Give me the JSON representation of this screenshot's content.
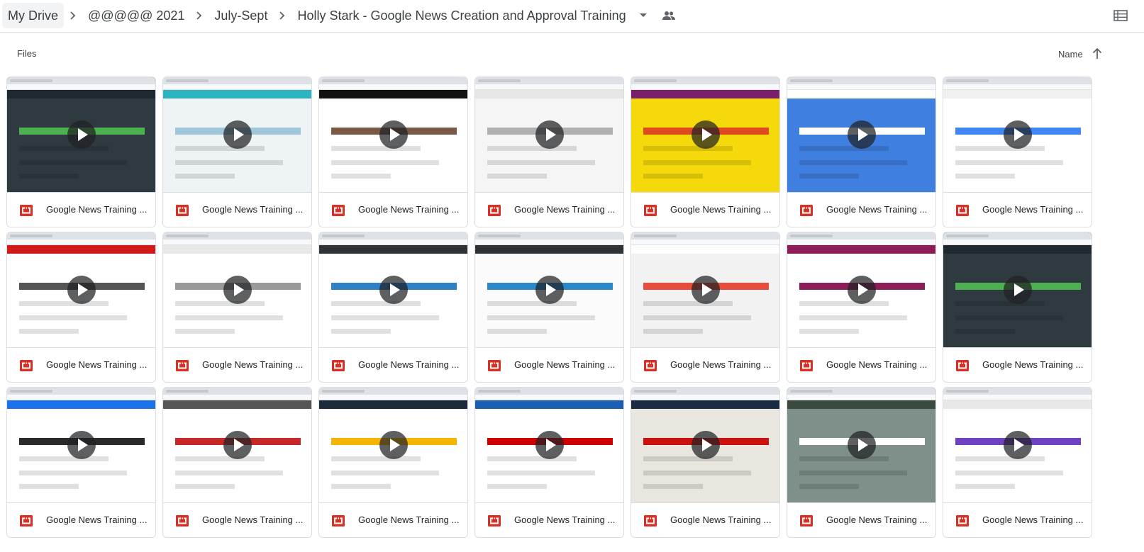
{
  "breadcrumb": {
    "items": [
      {
        "label": "My Drive"
      },
      {
        "label": "@@@@@ 2021"
      },
      {
        "label": "July-Sept"
      },
      {
        "label": "Holly Stark - Google News Creation and Approval Training"
      }
    ]
  },
  "icons": {
    "separator": "chevron-right-icon",
    "dropdown": "arrow-drop-down-icon",
    "shared": "people-icon",
    "view": "list-view-icon",
    "sort": "arrow-upward-icon",
    "play": "play-icon",
    "file_type": "video-file-icon"
  },
  "files_section": {
    "title": "Files",
    "sort_label": "Name",
    "sort_direction": "ascending"
  },
  "colors": {
    "video_icon": "#d93025",
    "text": "#3c4043",
    "border": "#dadce0",
    "crumb_bg": "#f1f3f4"
  },
  "files": [
    {
      "name": "Google News Training ...",
      "thumb": {
        "bg": "#2f3a40",
        "hdr": "#1f2a30",
        "accent": "#4caf50"
      }
    },
    {
      "name": "Google News Training ...",
      "thumb": {
        "bg": "#eef3f6",
        "hdr": "#2bb3c0",
        "accent": "#9fc6d9"
      }
    },
    {
      "name": "Google News Training ...",
      "thumb": {
        "bg": "#ffffff",
        "hdr": "#111111",
        "accent": "#7a5a45"
      }
    },
    {
      "name": "Google News Training ...",
      "thumb": {
        "bg": "#f5f5f5",
        "hdr": "#e6e6e6",
        "accent": "#b0b0b0"
      }
    },
    {
      "name": "Google News Training ...",
      "thumb": {
        "bg": "#f5d90a",
        "hdr": "#7a1f6b",
        "accent": "#e04a1f"
      }
    },
    {
      "name": "Google News Training ...",
      "thumb": {
        "bg": "#3f7fe0",
        "hdr": "#ffffff",
        "accent": "#ffffff"
      }
    },
    {
      "name": "Google News Training ...",
      "thumb": {
        "bg": "#ffffff",
        "hdr": "#f0f0f0",
        "accent": "#4285f4"
      }
    },
    {
      "name": "Google News Training ...",
      "thumb": {
        "bg": "#ffffff",
        "hdr": "#d11b1b",
        "accent": "#555555"
      }
    },
    {
      "name": "Google News Training ...",
      "thumb": {
        "bg": "#ffffff",
        "hdr": "#e8e8e8",
        "accent": "#999999"
      }
    },
    {
      "name": "Google News Training ...",
      "thumb": {
        "bg": "#ffffff",
        "hdr": "#2e3338",
        "accent": "#2f80c4"
      }
    },
    {
      "name": "Google News Training ...",
      "thumb": {
        "bg": "#fbfbfb",
        "hdr": "#2e3338",
        "accent": "#2a87c8"
      }
    },
    {
      "name": "Google News Training ...",
      "thumb": {
        "bg": "#f2f2f2",
        "hdr": "#ffffff",
        "accent": "#e74c3c"
      }
    },
    {
      "name": "Google News Training ...",
      "thumb": {
        "bg": "#ffffff",
        "hdr": "#8c1d59",
        "accent": "#8c1d59"
      }
    },
    {
      "name": "Google News Training ...",
      "thumb": {
        "bg": "#2f3a40",
        "hdr": "#1f2a30",
        "accent": "#4caf50"
      }
    },
    {
      "name": "Google News Training ...",
      "thumb": {
        "bg": "#ffffff",
        "hdr": "#1a73e8",
        "accent": "#2b2b2b"
      }
    },
    {
      "name": "Google News Training ...",
      "thumb": {
        "bg": "#ffffff",
        "hdr": "#555555",
        "accent": "#c62828"
      }
    },
    {
      "name": "Google News Training ...",
      "thumb": {
        "bg": "#ffffff",
        "hdr": "#1c2a3a",
        "accent": "#f4b400"
      }
    },
    {
      "name": "Google News Training ...",
      "thumb": {
        "bg": "#ffffff",
        "hdr": "#1a5fb4",
        "accent": "#cc0000"
      }
    },
    {
      "name": "Google News Training ...",
      "thumb": {
        "bg": "#e9e6e0",
        "hdr": "#1b2b44",
        "accent": "#cc1111"
      }
    },
    {
      "name": "Google News Training ...",
      "thumb": {
        "bg": "#7f8f8a",
        "hdr": "#3b4a3f",
        "accent": "#ffffff"
      }
    },
    {
      "name": "Google News Training ...",
      "thumb": {
        "bg": "#ffffff",
        "hdr": "#e8e8e8",
        "accent": "#6f42c1"
      }
    }
  ]
}
